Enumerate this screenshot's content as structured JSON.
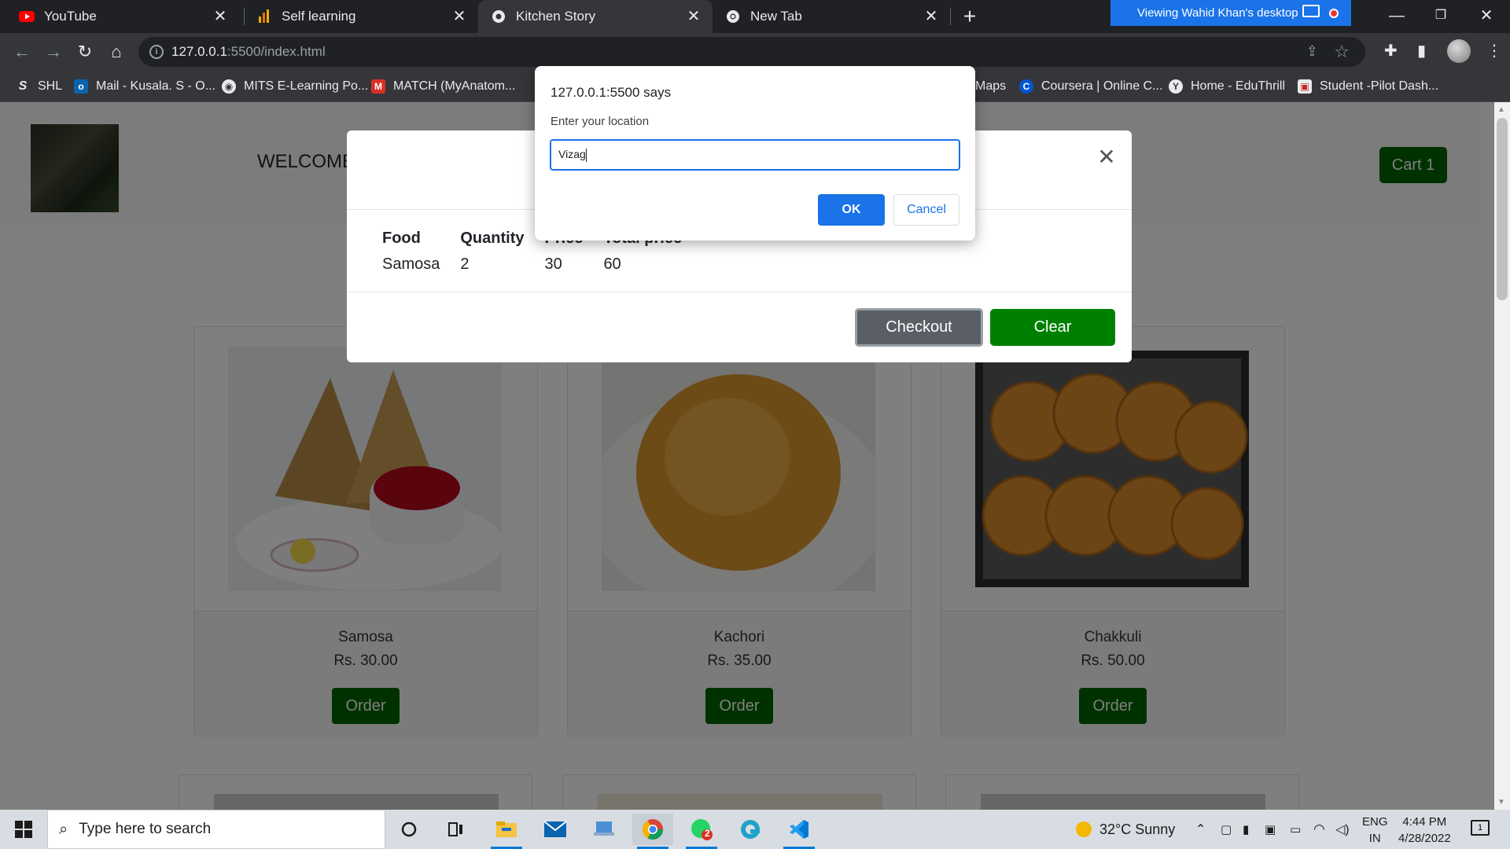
{
  "browser": {
    "tabs": [
      {
        "title": "YouTube",
        "favicon": "youtube-icon"
      },
      {
        "title": "Self learning",
        "favicon": "analytics-icon"
      },
      {
        "title": "Kitchen Story",
        "favicon": "globe-icon"
      },
      {
        "title": "New Tab",
        "favicon": "chrome-icon"
      }
    ],
    "active_tab": 2,
    "remote_banner": "Viewing Wahid Khan's desktop",
    "url_host": "127.0.0.1",
    "url_rest": ":5500/index.html",
    "bookmarks": [
      {
        "label": "SHL",
        "icon": "shl-icon"
      },
      {
        "label": "Mail - Kusala. S - O...",
        "icon": "outlook-icon"
      },
      {
        "label": "MITS E-Learning Po...",
        "icon": "globe-icon"
      },
      {
        "label": "MATCH (MyAnatom...",
        "icon": "match-icon"
      },
      {
        "label": "Maps",
        "icon": "maps-icon"
      },
      {
        "label": "Coursera | Online C...",
        "icon": "coursera-icon"
      },
      {
        "label": "Home - EduThrill",
        "icon": "eduthrill-icon"
      },
      {
        "label": "Student -Pilot Dash...",
        "icon": "student-icon"
      }
    ]
  },
  "page": {
    "welcome": "WELCOME",
    "cart_label": "Cart 1",
    "products": [
      {
        "name": "Samosa",
        "price": "Rs. 30.00",
        "order_label": "Order"
      },
      {
        "name": "Kachori",
        "price": "Rs. 35.00",
        "order_label": "Order"
      },
      {
        "name": "Chakkuli",
        "price": "Rs. 50.00",
        "order_label": "Order"
      }
    ]
  },
  "modal": {
    "columns": [
      "Food",
      "Quantity",
      "Price",
      "Total price"
    ],
    "rows": [
      [
        "Samosa",
        "2",
        "30",
        "60"
      ]
    ],
    "checkout_label": "Checkout",
    "clear_label": "Clear"
  },
  "prompt": {
    "title": "127.0.0.1:5500 says",
    "message": "Enter your location",
    "value": "Vizag",
    "ok_label": "OK",
    "cancel_label": "Cancel"
  },
  "taskbar": {
    "search_placeholder": "Type here to search",
    "weather": "32°C  Sunny",
    "lang_top": "ENG",
    "lang_bottom": "IN",
    "time": "4:44 PM",
    "date": "4/28/2022",
    "whatsapp_badge": "2",
    "notification_count": "1"
  },
  "colors": {
    "order_green": "#006400",
    "clear_green": "#008000",
    "prompt_blue": "#1a73e8",
    "youtube_red": "#ff0000"
  }
}
